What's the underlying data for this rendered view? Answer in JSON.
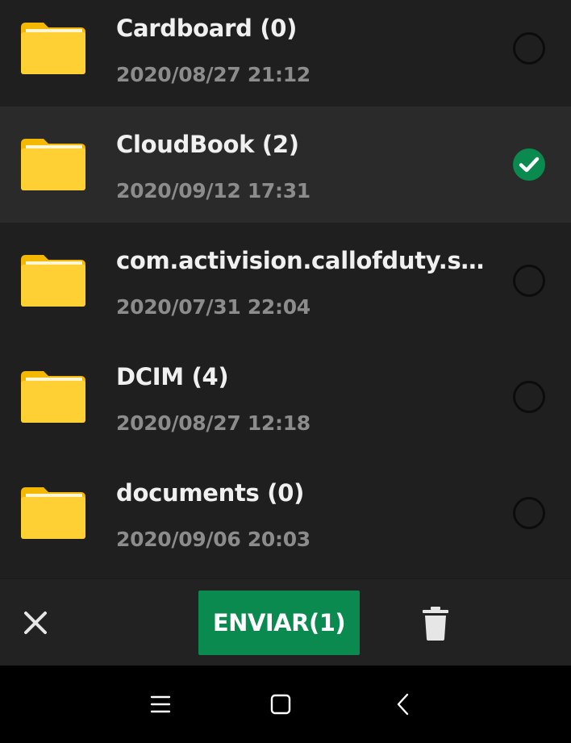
{
  "files": [
    {
      "name": "Cardboard (0)",
      "date": "2020/08/27 21:12",
      "selected": false
    },
    {
      "name": "CloudBook (2)",
      "date": "2020/09/12 17:31",
      "selected": true
    },
    {
      "name": "com.activision.callofduty.shoot...",
      "date": "2020/07/31 22:04",
      "selected": false
    },
    {
      "name": "DCIM (4)",
      "date": "2020/08/27 12:18",
      "selected": false
    },
    {
      "name": "documents (0)",
      "date": "2020/09/06 20:03",
      "selected": false
    }
  ],
  "actions": {
    "close_icon": "close-icon",
    "send_label": "ENVIAR(1)",
    "delete_icon": "trash-icon"
  },
  "nav": {
    "recent_icon": "menu-icon",
    "home_icon": "home-icon",
    "back_icon": "back-icon"
  },
  "colors": {
    "background": "#1f1f1f",
    "selected_row": "#2a2a2a",
    "accent_green": "#0a8a4f",
    "folder_yellow": "#ffcc2e",
    "date_gray": "#8c8c8c"
  }
}
